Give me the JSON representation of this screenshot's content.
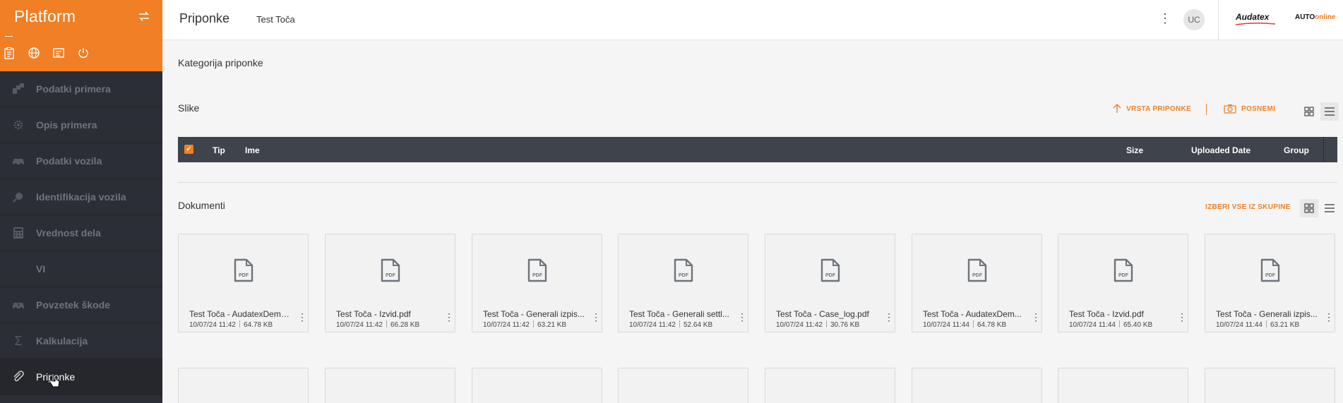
{
  "sidebar": {
    "title": "Platform",
    "tools": [
      "clipboard-icon",
      "globe-icon",
      "form-icon",
      "power-icon"
    ],
    "items": [
      {
        "label": "Podatki primera",
        "icon": "data-blocks-icon"
      },
      {
        "label": "Opis primera",
        "icon": "gear-icon"
      },
      {
        "label": "Podatki vozila",
        "icon": "car-icon"
      },
      {
        "label": "Identifikacija vozila",
        "icon": "magnifier-icon"
      },
      {
        "label": "Vrednost dela",
        "icon": "calculator-icon"
      },
      {
        "label": "VI",
        "icon": ""
      },
      {
        "label": "Povzetek škode",
        "icon": "damaged-car-icon"
      },
      {
        "label": "Kalkulacija",
        "icon": "sigma-icon"
      },
      {
        "label": "Priponke",
        "icon": "paperclip-icon",
        "active": true
      }
    ]
  },
  "topbar": {
    "title": "Priponke",
    "case": "Test Toča",
    "avatar": "UC",
    "brand1": "Audatex",
    "brand2_a": "AUTO",
    "brand2_b": "online"
  },
  "main": {
    "category_heading": "Kategorija priponke",
    "images_heading": "Slike",
    "action_type": "VRSTA PRIPONKE",
    "action_capture": "POSNEMI",
    "table": {
      "columns": [
        "Tip",
        "Ime",
        "Size",
        "Uploaded Date",
        "Group"
      ]
    },
    "documents_heading": "Dokumenti",
    "action_select_all": "IZBERI VSE IZ SKUPINE"
  },
  "documents": [
    {
      "name": "Test Toča - AudatexDemo...",
      "date": "10/07/24 11:42",
      "size": "64.78 KB"
    },
    {
      "name": "Test Toča - Izvid.pdf",
      "date": "10/07/24 11:42",
      "size": "66.28 KB"
    },
    {
      "name": "Test Toča - Generali izpis...",
      "date": "10/07/24 11:42",
      "size": "63.21 KB"
    },
    {
      "name": "Test Toča - Generali settl...",
      "date": "10/07/24 11:42",
      "size": "52.64 KB"
    },
    {
      "name": "Test Toča - Case_log.pdf",
      "date": "10/07/24 11:42",
      "size": "30.76 KB"
    },
    {
      "name": "Test Toča - AudatexDem...",
      "date": "10/07/24 11:44",
      "size": "64.78 KB"
    },
    {
      "name": "Test Toča - Izvid.pdf",
      "date": "10/07/24 11:44",
      "size": "65.40 KB"
    },
    {
      "name": "Test Toča - Generali izpis...",
      "date": "10/07/24 11:44",
      "size": "63.21 KB"
    }
  ]
}
